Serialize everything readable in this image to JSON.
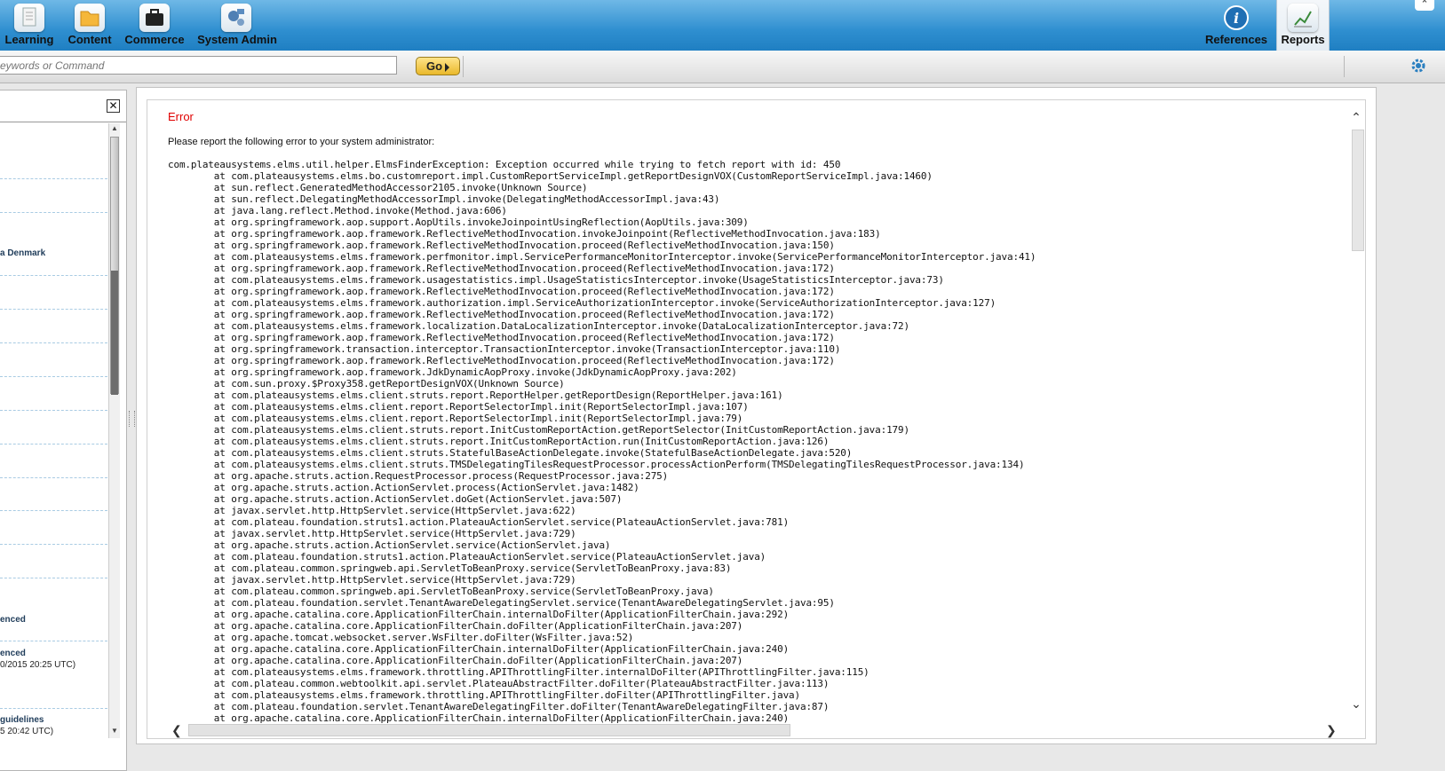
{
  "nav": {
    "learning": "Learning",
    "content": "Content",
    "commerce": "Commerce",
    "system_admin": "System Admin",
    "references": "References",
    "reports": "Reports"
  },
  "search": {
    "placeholder": "eywords or Command",
    "go_label": "Go"
  },
  "left_panel": {
    "items": [
      "a Denmark",
      "enced",
      "enced",
      "0/2015 20:25 UTC)",
      "guidelines",
      "5 20:42 UTC)"
    ]
  },
  "error": {
    "title": "Error",
    "message": "Please report the following error to your system administrator:",
    "trace": "com.plateausystems.elms.util.helper.ElmsFinderException: Exception occurred while trying to fetch report with id: 450\n\tat com.plateausystems.elms.bo.customreport.impl.CustomReportServiceImpl.getReportDesignVOX(CustomReportServiceImpl.java:1460)\n\tat sun.reflect.GeneratedMethodAccessor2105.invoke(Unknown Source)\n\tat sun.reflect.DelegatingMethodAccessorImpl.invoke(DelegatingMethodAccessorImpl.java:43)\n\tat java.lang.reflect.Method.invoke(Method.java:606)\n\tat org.springframework.aop.support.AopUtils.invokeJoinpointUsingReflection(AopUtils.java:309)\n\tat org.springframework.aop.framework.ReflectiveMethodInvocation.invokeJoinpoint(ReflectiveMethodInvocation.java:183)\n\tat org.springframework.aop.framework.ReflectiveMethodInvocation.proceed(ReflectiveMethodInvocation.java:150)\n\tat com.plateausystems.elms.framework.perfmonitor.impl.ServicePerformanceMonitorInterceptor.invoke(ServicePerformanceMonitorInterceptor.java:41)\n\tat org.springframework.aop.framework.ReflectiveMethodInvocation.proceed(ReflectiveMethodInvocation.java:172)\n\tat com.plateausystems.elms.framework.usagestatistics.impl.UsageStatisticsInterceptor.invoke(UsageStatisticsInterceptor.java:73)\n\tat org.springframework.aop.framework.ReflectiveMethodInvocation.proceed(ReflectiveMethodInvocation.java:172)\n\tat com.plateausystems.elms.framework.authorization.impl.ServiceAuthorizationInterceptor.invoke(ServiceAuthorizationInterceptor.java:127)\n\tat org.springframework.aop.framework.ReflectiveMethodInvocation.proceed(ReflectiveMethodInvocation.java:172)\n\tat com.plateausystems.elms.framework.localization.DataLocalizationInterceptor.invoke(DataLocalizationInterceptor.java:72)\n\tat org.springframework.aop.framework.ReflectiveMethodInvocation.proceed(ReflectiveMethodInvocation.java:172)\n\tat org.springframework.transaction.interceptor.TransactionInterceptor.invoke(TransactionInterceptor.java:110)\n\tat org.springframework.aop.framework.ReflectiveMethodInvocation.proceed(ReflectiveMethodInvocation.java:172)\n\tat org.springframework.aop.framework.JdkDynamicAopProxy.invoke(JdkDynamicAopProxy.java:202)\n\tat com.sun.proxy.$Proxy358.getReportDesignVOX(Unknown Source)\n\tat com.plateausystems.elms.client.struts.report.ReportHelper.getReportDesign(ReportHelper.java:161)\n\tat com.plateausystems.elms.client.report.ReportSelectorImpl.init(ReportSelectorImpl.java:107)\n\tat com.plateausystems.elms.client.report.ReportSelectorImpl.init(ReportSelectorImpl.java:79)\n\tat com.plateausystems.elms.client.struts.report.InitCustomReportAction.getReportSelector(InitCustomReportAction.java:179)\n\tat com.plateausystems.elms.client.struts.report.InitCustomReportAction.run(InitCustomReportAction.java:126)\n\tat com.plateausystems.elms.client.struts.StatefulBaseActionDelegate.invoke(StatefulBaseActionDelegate.java:520)\n\tat com.plateausystems.elms.client.struts.TMSDelegatingTilesRequestProcessor.processActionPerform(TMSDelegatingTilesRequestProcessor.java:134)\n\tat org.apache.struts.action.RequestProcessor.process(RequestProcessor.java:275)\n\tat org.apache.struts.action.ActionServlet.process(ActionServlet.java:1482)\n\tat org.apache.struts.action.ActionServlet.doGet(ActionServlet.java:507)\n\tat javax.servlet.http.HttpServlet.service(HttpServlet.java:622)\n\tat com.plateau.foundation.struts1.action.PlateauActionServlet.service(PlateauActionServlet.java:781)\n\tat javax.servlet.http.HttpServlet.service(HttpServlet.java:729)\n\tat org.apache.struts.action.ActionServlet.service(ActionServlet.java)\n\tat com.plateau.foundation.struts1.action.PlateauActionServlet.service(PlateauActionServlet.java)\n\tat com.plateau.common.springweb.api.ServletToBeanProxy.service(ServletToBeanProxy.java:83)\n\tat javax.servlet.http.HttpServlet.service(HttpServlet.java:729)\n\tat com.plateau.common.springweb.api.ServletToBeanProxy.service(ServletToBeanProxy.java)\n\tat com.plateau.foundation.servlet.TenantAwareDelegatingServlet.service(TenantAwareDelegatingServlet.java:95)\n\tat org.apache.catalina.core.ApplicationFilterChain.internalDoFilter(ApplicationFilterChain.java:292)\n\tat org.apache.catalina.core.ApplicationFilterChain.doFilter(ApplicationFilterChain.java:207)\n\tat org.apache.tomcat.websocket.server.WsFilter.doFilter(WsFilter.java:52)\n\tat org.apache.catalina.core.ApplicationFilterChain.internalDoFilter(ApplicationFilterChain.java:240)\n\tat org.apache.catalina.core.ApplicationFilterChain.doFilter(ApplicationFilterChain.java:207)\n\tat com.plateausystems.elms.framework.throttling.APIThrottlingFilter.internalDoFilter(APIThrottlingFilter.java:115)\n\tat com.plateau.common.webtoolkit.api.servlet.PlateauAbstractFilter.doFilter(PlateauAbstractFilter.java:113)\n\tat com.plateausystems.elms.framework.throttling.APIThrottlingFilter.doFilter(APIThrottlingFilter.java)\n\tat com.plateau.foundation.servlet.TenantAwareDelegatingFilter.doFilter(TenantAwareDelegatingFilter.java:87)\n\tat org.apache.catalina.core.ApplicationFilterChain.internalDoFilter(ApplicationFilterChain.java:240)"
  },
  "colors": {
    "header_blue": "#2f8fd0",
    "error_red": "#e00000",
    "go_gold": "#e9b82a",
    "settings_blue": "#2a7fc0"
  }
}
